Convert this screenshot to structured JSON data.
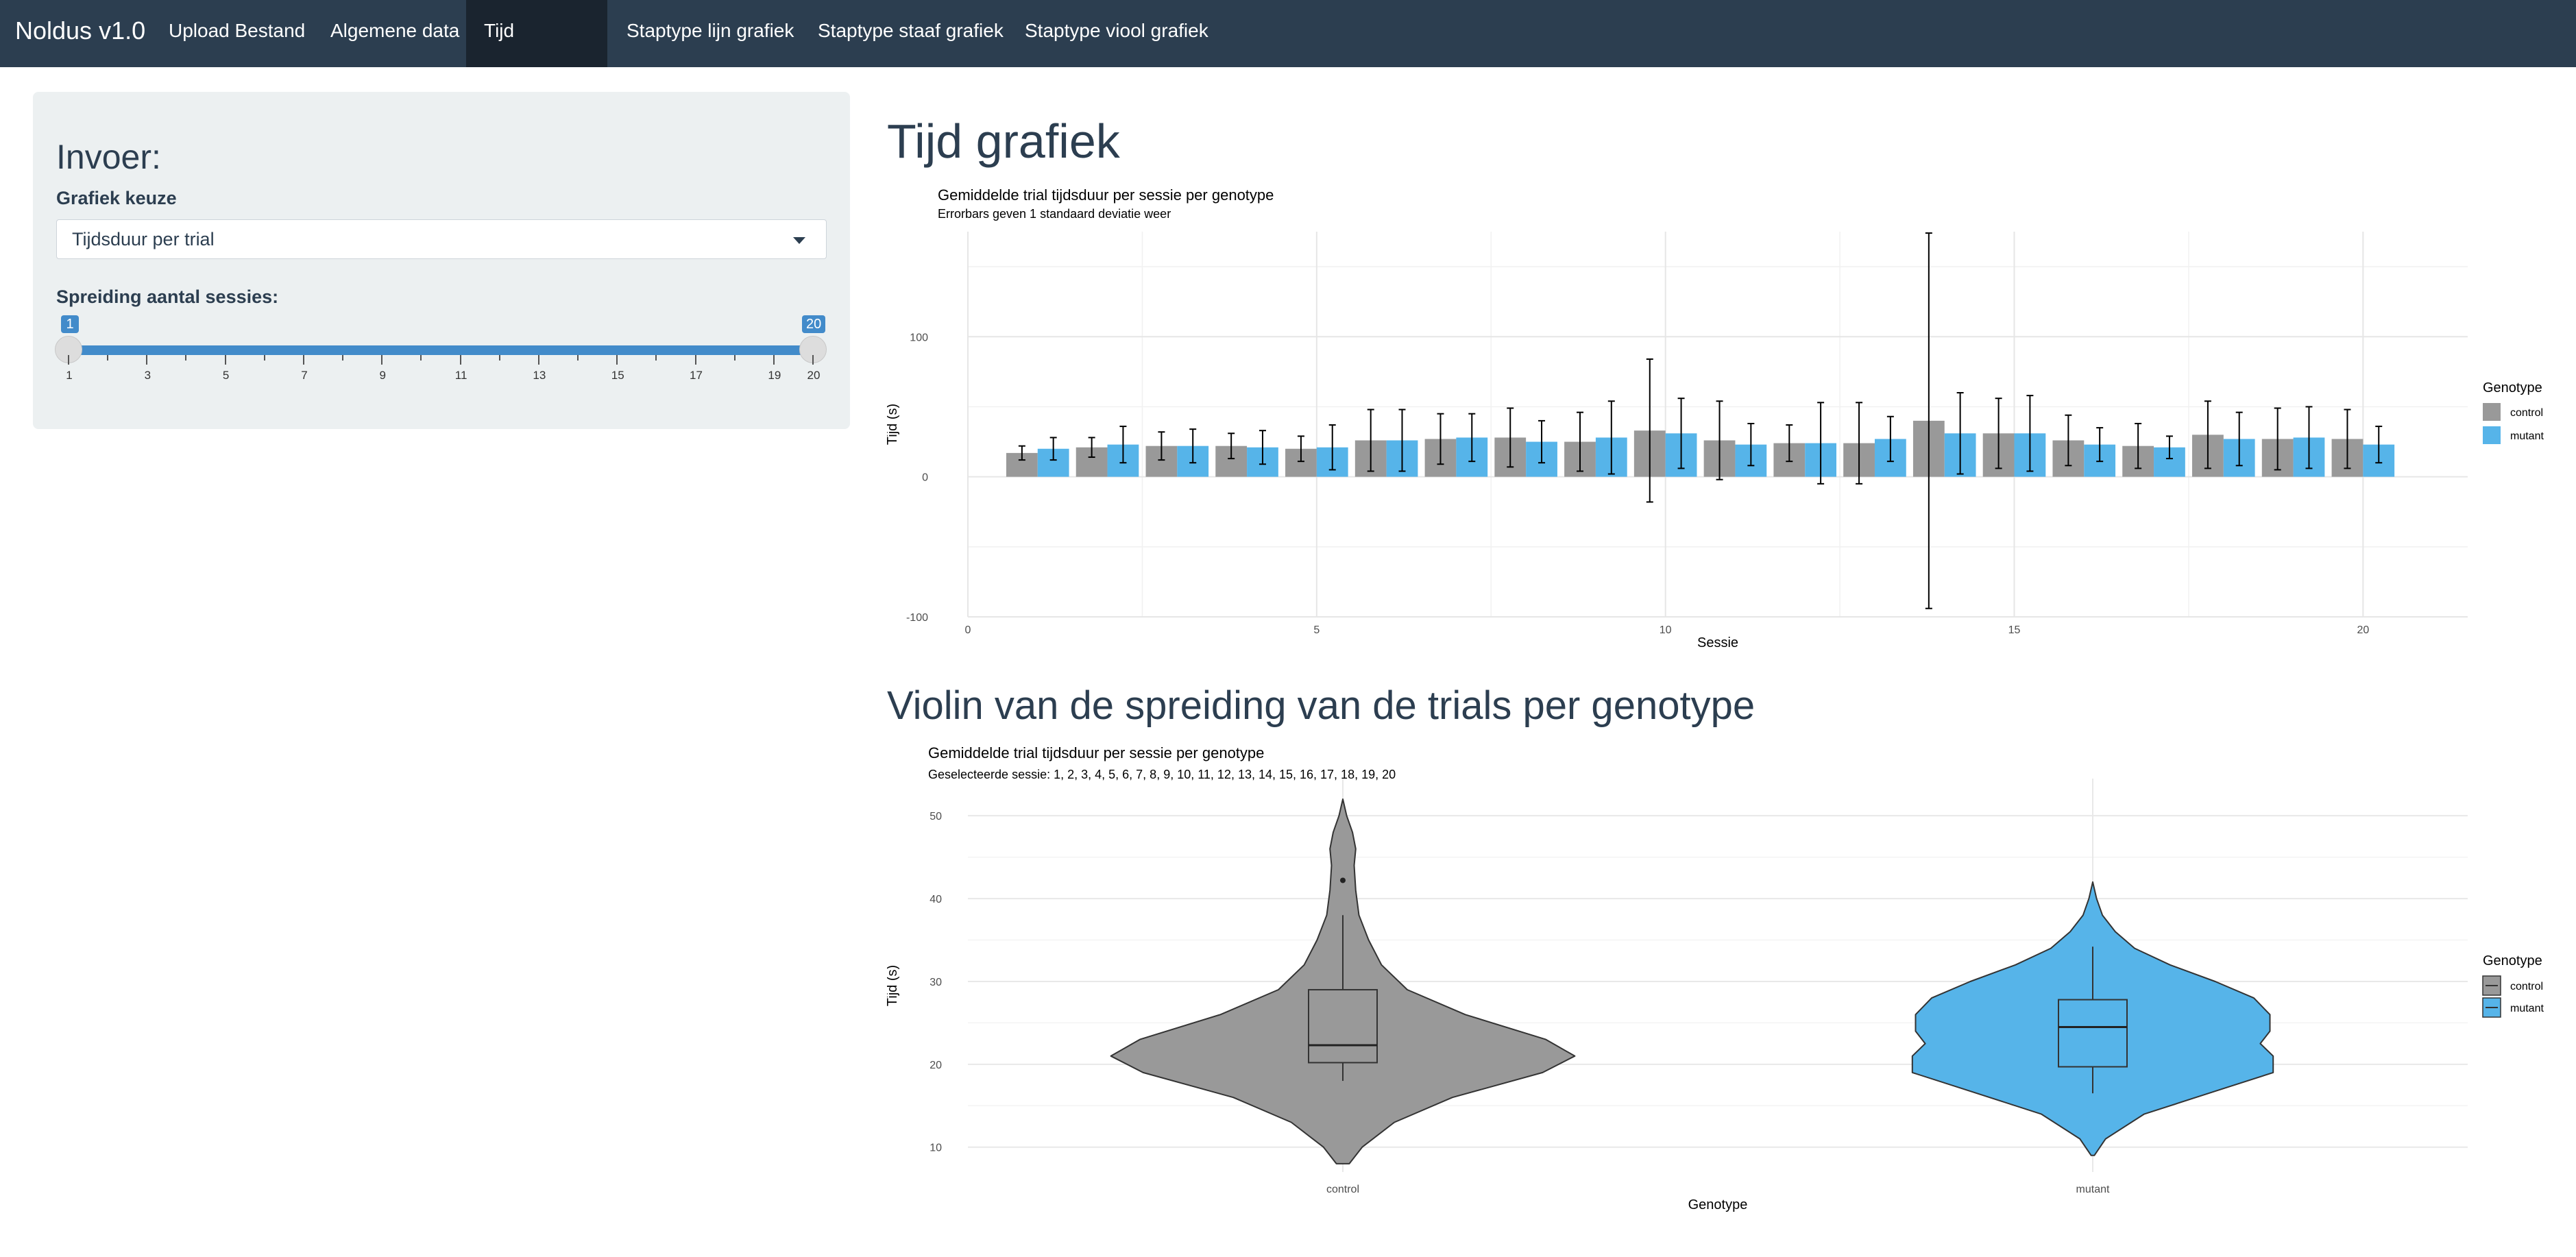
{
  "navbar": {
    "brand": "Noldus v1.0",
    "tabs": [
      {
        "label": "Upload Bestand"
      },
      {
        "label": "Algemene data"
      },
      {
        "label": "Tijd grafieken",
        "active": true
      },
      {
        "label": "Staptype lijn grafiek"
      },
      {
        "label": "Staptype staaf grafiek"
      },
      {
        "label": "Staptype viool grafiek"
      }
    ]
  },
  "sidebar": {
    "title": "Invoer:",
    "select_label": "Grafiek keuze",
    "select_value": "Tijdsduur per trial",
    "slider_label": "Spreiding aantal sessies:",
    "slider_min_value": "1",
    "slider_max_value": "20",
    "slider_ticks": [
      "1",
      "3",
      "5",
      "7",
      "9",
      "11",
      "13",
      "15",
      "17",
      "19",
      "20"
    ]
  },
  "main": {
    "heading1": "Tijd grafiek",
    "heading2": "Violin van de spreiding van de trials per genotype"
  },
  "colors": {
    "control": "#999999",
    "mutant": "#56b4e9",
    "navbar": "#2c3e50"
  },
  "chart_data": [
    {
      "type": "bar",
      "title": "Gemiddelde trial tijdsduur per sessie per genotype",
      "subtitle": "Errorbars geven 1 standaard deviatie weer",
      "xlabel": "Sessie",
      "ylabel": "Tijd (s)",
      "xlim": [
        0,
        21.5
      ],
      "ylim": [
        -100,
        175
      ],
      "x_ticks": [
        "0",
        "5",
        "10",
        "15",
        "20"
      ],
      "y_ticks": [
        "-100",
        "0",
        "100"
      ],
      "legend_title": "Genotype",
      "legend_position": "right",
      "x": [
        1,
        2,
        3,
        4,
        5,
        6,
        7,
        8,
        9,
        10,
        11,
        12,
        13,
        14,
        15,
        16,
        17,
        18,
        19,
        20
      ],
      "series": [
        {
          "name": "control",
          "values": [
            17,
            21,
            22,
            22,
            20,
            26,
            27,
            28,
            25,
            33,
            26,
            24,
            24,
            40,
            31,
            26,
            22,
            30,
            27,
            27
          ],
          "sd": [
            5,
            7,
            10,
            9,
            9,
            22,
            18,
            21,
            21,
            51,
            28,
            13,
            29,
            134,
            25,
            18,
            16,
            24,
            22,
            21
          ]
        },
        {
          "name": "mutant",
          "values": [
            20,
            23,
            22,
            21,
            21,
            26,
            28,
            25,
            28,
            31,
            23,
            24,
            27,
            31,
            31,
            23,
            21,
            27,
            28,
            23
          ],
          "sd": [
            8,
            13,
            12,
            12,
            16,
            22,
            17,
            15,
            26,
            25,
            15,
            29,
            16,
            29,
            27,
            12,
            8,
            19,
            22,
            13
          ]
        }
      ]
    },
    {
      "type": "violin",
      "title": "Gemiddelde trial tijdsduur per sessie per genotype",
      "subtitle": "Geselecteerde sessie: 1, 2, 3, 4, 5, 6, 7, 8, 9, 10, 11, 12, 13, 14, 15, 16, 17, 18, 19, 20",
      "xlabel": "Genotype",
      "ylabel": "Tijd (s)",
      "categories": [
        "control",
        "mutant"
      ],
      "ylim": [
        7,
        52
      ],
      "y_ticks": [
        "10",
        "20",
        "30",
        "40",
        "50"
      ],
      "legend_title": "Genotype",
      "legend_position": "right",
      "groups": [
        {
          "name": "control",
          "min": 8,
          "max": 52,
          "box": {
            "whisker_low": 18,
            "q1": 20.2,
            "median": 22.3,
            "q3": 29,
            "whisker_high": 38
          },
          "outliers": [
            42.2
          ],
          "density": [
            [
              8,
              0.02
            ],
            [
              10,
              0.06
            ],
            [
              13,
              0.16
            ],
            [
              16,
              0.34
            ],
            [
              19,
              0.62
            ],
            [
              21,
              0.72
            ],
            [
              23,
              0.63
            ],
            [
              26,
              0.38
            ],
            [
              29,
              0.2
            ],
            [
              32,
              0.12
            ],
            [
              35,
              0.08
            ],
            [
              38,
              0.05
            ],
            [
              41,
              0.04
            ],
            [
              44,
              0.035
            ],
            [
              46,
              0.04
            ],
            [
              48,
              0.03
            ],
            [
              50,
              0.012
            ],
            [
              52,
              0
            ]
          ]
        },
        {
          "name": "mutant",
          "min": 9,
          "max": 42,
          "box": {
            "whisker_low": 16.5,
            "q1": 19.7,
            "median": 24.5,
            "q3": 27.8,
            "whisker_high": 34.2
          },
          "outliers": [],
          "density": [
            [
              9,
              0.005
            ],
            [
              11,
              0.04
            ],
            [
              14,
              0.16
            ],
            [
              17,
              0.4
            ],
            [
              19,
              0.56
            ],
            [
              21,
              0.56
            ],
            [
              22.5,
              0.52
            ],
            [
              24,
              0.55
            ],
            [
              26,
              0.55
            ],
            [
              28,
              0.5
            ],
            [
              30,
              0.38
            ],
            [
              32,
              0.24
            ],
            [
              34,
              0.13
            ],
            [
              36,
              0.07
            ],
            [
              38,
              0.03
            ],
            [
              40,
              0.012
            ],
            [
              42,
              0
            ]
          ]
        }
      ]
    }
  ]
}
